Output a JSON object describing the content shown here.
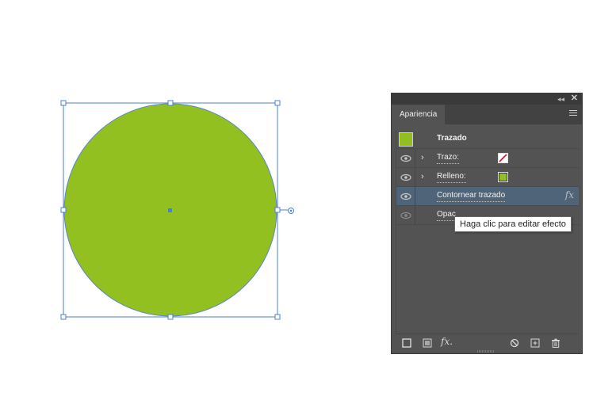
{
  "canvas": {
    "shape": "circle",
    "fill_color": "#92c021",
    "stroke_color": "#5b86c8",
    "selection_color": "#4a7fd6"
  },
  "panel": {
    "tab_label": "Apariencia",
    "icons": [
      "collapse-icon",
      "close-icon",
      "menu-icon"
    ],
    "object": {
      "label": "Trazado",
      "thumb_color": "#91bf20"
    },
    "rows": [
      {
        "label": "Trazo:",
        "swatch": "none-red-slash"
      },
      {
        "label": "Relleno:",
        "swatch_color": "#91bf20"
      },
      {
        "label": "Contornear trazado",
        "fx": "fx",
        "selected": true
      },
      {
        "label": "Opac"
      }
    ],
    "tooltip": "Haga clic para editar efecto",
    "bottom_icons": [
      "new-stroke-icon",
      "new-fill-icon",
      "add-effect-icon",
      "clear-icon",
      "duplicate-icon",
      "delete-icon"
    ]
  }
}
